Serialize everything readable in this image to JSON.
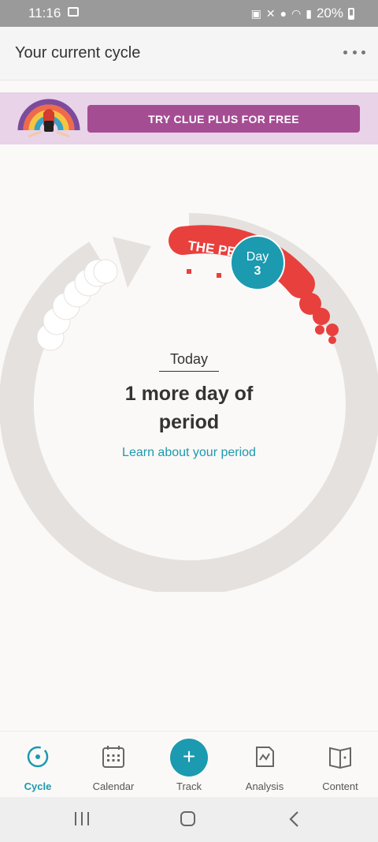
{
  "status_bar": {
    "time": "11:16",
    "battery": "20%",
    "icons": [
      "gallery-icon",
      "lock-icon",
      "mute-icon",
      "location-icon",
      "wifi-icon",
      "signal-icon",
      "battery-icon"
    ]
  },
  "header": {
    "title": "Your current cycle",
    "menu_icon": "more-horizontal-icon"
  },
  "promo": {
    "button_label": "TRY CLUE PLUS FOR FREE"
  },
  "cycle": {
    "phase_label": "THE PERIOD",
    "phase_label_visible": "THE PE",
    "day_title": "Day",
    "day_number": "3",
    "today_label": "Today",
    "message_line1": "1 more day of",
    "message_line2": "period",
    "link_text": "Learn about your period",
    "colors": {
      "period": "#e8403d",
      "ring": "#e5e1df",
      "day_badge": "#1b9ab0",
      "fertile": "#ffffff"
    }
  },
  "bottom_nav": [
    {
      "label": "Cycle",
      "icon": "cycle-icon",
      "active": true
    },
    {
      "label": "Calendar",
      "icon": "calendar-icon",
      "active": false
    },
    {
      "label": "Track",
      "icon": "plus-icon",
      "active": false
    },
    {
      "label": "Analysis",
      "icon": "analysis-icon",
      "active": false
    },
    {
      "label": "Content",
      "icon": "book-icon",
      "active": false
    }
  ],
  "accent_color": "#1b9ab0"
}
